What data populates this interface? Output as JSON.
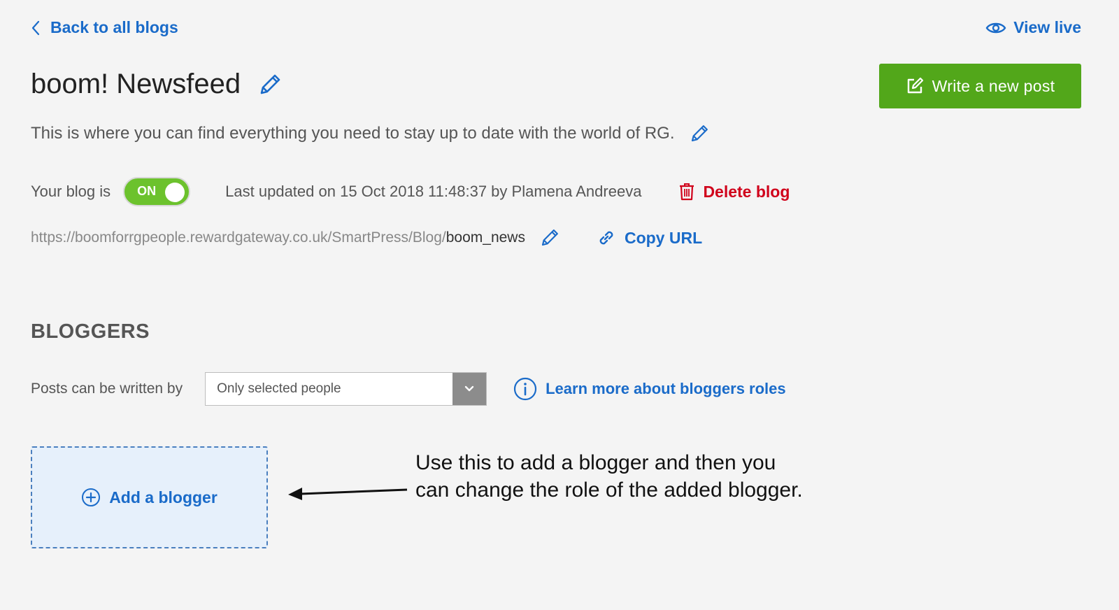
{
  "nav": {
    "back_label": "Back to all blogs",
    "view_live_label": "View live"
  },
  "blog": {
    "title": "boom! Newsfeed",
    "description": "This is where you can find everything you need to stay up to date with the world of RG.",
    "write_button_label": "Write a new post",
    "status_prefix": "Your blog is",
    "toggle_label": "ON",
    "last_updated": "Last updated on 15 Oct 2018 11:48:37 by Plamena Andreeva",
    "delete_label": "Delete blog",
    "url_base": "https://boomforrgpeople.rewardgateway.co.uk/SmartPress/Blog/",
    "url_slug": "boom_news",
    "copy_url_label": "Copy URL"
  },
  "bloggers": {
    "heading": "BLOGGERS",
    "posts_label": "Posts can be written by",
    "select_value": "Only selected people",
    "learn_more_label": "Learn more about bloggers roles",
    "add_label": "Add a blogger"
  },
  "annotation": {
    "text": "Use this to add a blogger and then you can change the role of the added blogger."
  },
  "colors": {
    "link": "#1a6bc9",
    "primary_button": "#52a71a",
    "toggle_on": "#6cc22d",
    "danger": "#d0021b",
    "background": "#f4f4f4"
  }
}
